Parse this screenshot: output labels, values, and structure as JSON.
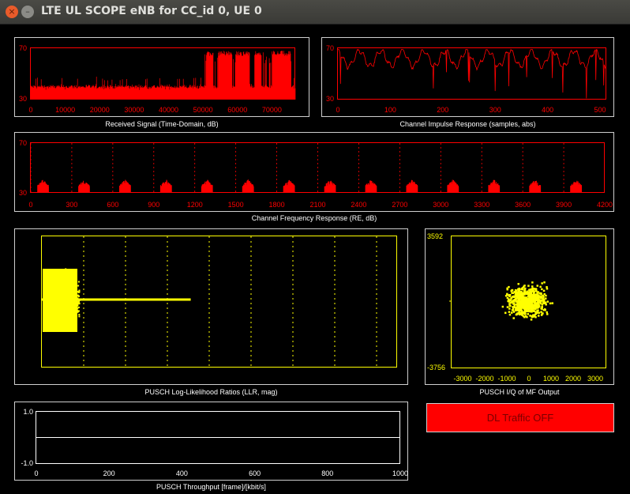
{
  "window": {
    "title": "LTE UL SCOPE eNB for CC_id 0, UE 0",
    "close_glyph": "×",
    "min_glyph": "–"
  },
  "colors": {
    "signal": "#ff0000",
    "llr": "#ffff00",
    "frame": "#cfcfcf",
    "text": "#ffffff"
  },
  "panels": {
    "time_domain": {
      "caption": "Received Signal (Time-Domain, dB)",
      "y_ticks": [
        "70",
        "30"
      ],
      "x_ticks": [
        "0",
        "10000",
        "20000",
        "30000",
        "40000",
        "50000",
        "60000",
        "70000"
      ]
    },
    "impulse": {
      "caption": "Channel Impulse Response (samples, abs)",
      "y_ticks": [
        "70",
        "30"
      ],
      "x_ticks": [
        "0",
        "100",
        "200",
        "300",
        "400",
        "500"
      ]
    },
    "freq": {
      "caption": "Channel Frequency  Response (RE, dB)",
      "y_ticks": [
        "70",
        "30"
      ],
      "x_ticks": [
        "0",
        "300",
        "600",
        "900",
        "1200",
        "1500",
        "1800",
        "2100",
        "2400",
        "2700",
        "3000",
        "3300",
        "3600",
        "3900",
        "4200"
      ]
    },
    "llr": {
      "caption": "PUSCH Log-Likelihood Ratios (LLR, mag)"
    },
    "iq": {
      "caption": "PUSCH I/Q of MF Output",
      "y_ticks": [
        "3592",
        "-3756"
      ],
      "x_ticks": [
        "-3000",
        "-2000",
        "-1000",
        "0",
        "1000",
        "2000",
        "3000"
      ]
    },
    "throughput": {
      "caption": "PUSCH Throughput [frame]/[kbit/s]",
      "y_ticks": [
        "1.0",
        "-1.0"
      ],
      "x_ticks": [
        "0",
        "200",
        "400",
        "600",
        "800",
        "1000"
      ]
    }
  },
  "dl_traffic_button": "DL Traffic OFF",
  "chart_data": [
    {
      "type": "area",
      "title": "Received Signal (Time-Domain, dB)",
      "xlim": [
        0,
        76800
      ],
      "ylim": [
        30,
        70
      ],
      "baseline_db": 40,
      "burst_start_x": 50400,
      "burst_db": 68,
      "bursts": [
        [
          51000,
          53000
        ],
        [
          54500,
          58500
        ],
        [
          59500,
          63500
        ],
        [
          65000,
          67000
        ],
        [
          70000,
          75500
        ]
      ]
    },
    {
      "type": "line",
      "title": "Channel Impulse Response (samples, abs)",
      "xlim": [
        0,
        512
      ],
      "ylim": [
        30,
        70
      ]
    },
    {
      "type": "bar",
      "title": "Channel Frequency  Response (RE, dB)",
      "xlim": [
        0,
        4200
      ],
      "ylim": [
        30,
        70
      ],
      "cluster_centers": [
        90,
        390,
        690,
        990,
        1290,
        1590,
        1890,
        2190,
        2490,
        2790,
        3090,
        3390,
        3690,
        3990
      ]
    },
    {
      "type": "scatter",
      "title": "PUSCH Log-Likelihood Ratios (LLR, mag)",
      "line_end_fraction": 0.42
    },
    {
      "type": "scatter",
      "title": "PUSCH I/Q of MF Output",
      "xlim": [
        -3500,
        3500
      ],
      "ylim": [
        -3756,
        3592
      ]
    },
    {
      "type": "line",
      "title": "PUSCH Throughput [frame]/[kbit/s]",
      "xlim": [
        0,
        1000
      ],
      "ylim": [
        -1,
        1
      ],
      "values": [
        0
      ]
    }
  ]
}
